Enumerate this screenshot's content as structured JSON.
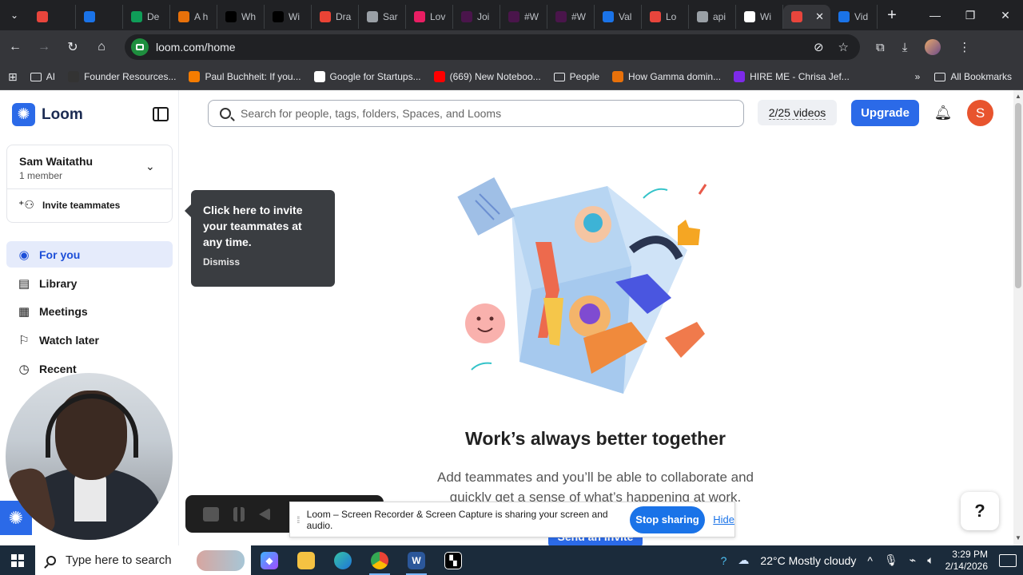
{
  "browser": {
    "tabs": [
      {
        "label": "",
        "icon": "loom-record-icon",
        "color": "#e8453c"
      },
      {
        "label": "",
        "icon": "gear-icon",
        "color": "#1a73e8"
      },
      {
        "label": "De",
        "icon": "sheets-icon",
        "color": "#0f9d58"
      },
      {
        "label": "A h",
        "icon": "runner-icon",
        "color": "#e8710a"
      },
      {
        "label": "Wh",
        "icon": "medium-icon",
        "color": "#000000"
      },
      {
        "label": "Wi",
        "icon": "w-icon",
        "color": "#000000"
      },
      {
        "label": "Dra",
        "icon": "gmail-icon",
        "color": "#ea4335"
      },
      {
        "label": "Sar",
        "icon": "globe-icon",
        "color": "#9aa0a6"
      },
      {
        "label": "Lov",
        "icon": "heart-icon",
        "color": "#e91e63"
      },
      {
        "label": "Joi",
        "icon": "slack-icon",
        "color": "#4a154b"
      },
      {
        "label": "#W",
        "icon": "slack-icon",
        "color": "#4a154b"
      },
      {
        "label": "#W",
        "icon": "slack-icon",
        "color": "#4a154b"
      },
      {
        "label": "Val",
        "icon": "gear-icon",
        "color": "#1a73e8"
      },
      {
        "label": "Lo",
        "icon": "star-icon",
        "color": "#e8453c"
      },
      {
        "label": "api",
        "icon": "globe-icon",
        "color": "#9aa0a6"
      },
      {
        "label": "Wi",
        "icon": "openai-icon",
        "color": "#ffffff"
      },
      {
        "label": "",
        "icon": "loom-record-icon",
        "color": "#e8453c",
        "active": true
      },
      {
        "label": "Vid",
        "icon": "gear-icon",
        "color": "#1a73e8"
      }
    ],
    "url": "loom.com/home",
    "bookmarks": [
      {
        "label": "AI",
        "icon": "folder-icon"
      },
      {
        "label": "Founder Resources...",
        "icon": "bookmark-icon",
        "color": "#333333"
      },
      {
        "label": "Paul Buchheit: If you...",
        "icon": "blogger-icon",
        "color": "#f57c00"
      },
      {
        "label": "Google for Startups...",
        "icon": "google-icon",
        "color": "#ffffff"
      },
      {
        "label": "(669) New Noteboo...",
        "icon": "youtube-icon",
        "color": "#ff0000"
      },
      {
        "label": "People",
        "icon": "folder-icon"
      },
      {
        "label": "How Gamma domin...",
        "icon": "gamma-icon",
        "color": "#e8710a"
      },
      {
        "label": "HIRE ME - Chrisa Jef...",
        "icon": "canva-icon",
        "color": "#7d2ae8"
      }
    ],
    "all_bookmarks": "All Bookmarks"
  },
  "sidebar": {
    "brand": "Loom",
    "workspace_name": "Sam Waitathu",
    "workspace_members": "1 member",
    "invite_label": "Invite teammates",
    "nav": [
      {
        "label": "For you",
        "icon": "user-circle-icon",
        "active": true
      },
      {
        "label": "Library",
        "icon": "library-icon"
      },
      {
        "label": "Meetings",
        "icon": "calendar-icon"
      },
      {
        "label": "Watch later",
        "icon": "bookmark-icon"
      },
      {
        "label": "Recent",
        "icon": "clock-icon"
      }
    ]
  },
  "header": {
    "search_placeholder": "Search for people, tags, folders, Spaces, and Looms",
    "video_count": "2/25 videos",
    "upgrade_label": "Upgrade",
    "avatar_initial": "S"
  },
  "tooltip": {
    "text": "Click here to invite your teammates at any time.",
    "dismiss": "Dismiss"
  },
  "empty_state": {
    "headline": "Work’s always better together",
    "subtext": "Add teammates and you’ll be able to collaborate and quickly get a sense of what’s happening at work.",
    "cta": "Send an invite"
  },
  "help_label": "?",
  "share_bar": {
    "message": "Loom – Screen Recorder & Screen Capture is sharing your screen and audio.",
    "stop": "Stop sharing",
    "hide": "Hide"
  },
  "taskbar": {
    "search_placeholder": "Type here to search",
    "weather": "22°C  Mostly cloudy",
    "time": "3:29 PM",
    "date": "2/14/2026"
  },
  "colors": {
    "loom_blue": "#2b6ae8",
    "nav_active_bg": "#e5ebfb",
    "avatar": "#e8542e",
    "chrome_dark": "#202124"
  }
}
